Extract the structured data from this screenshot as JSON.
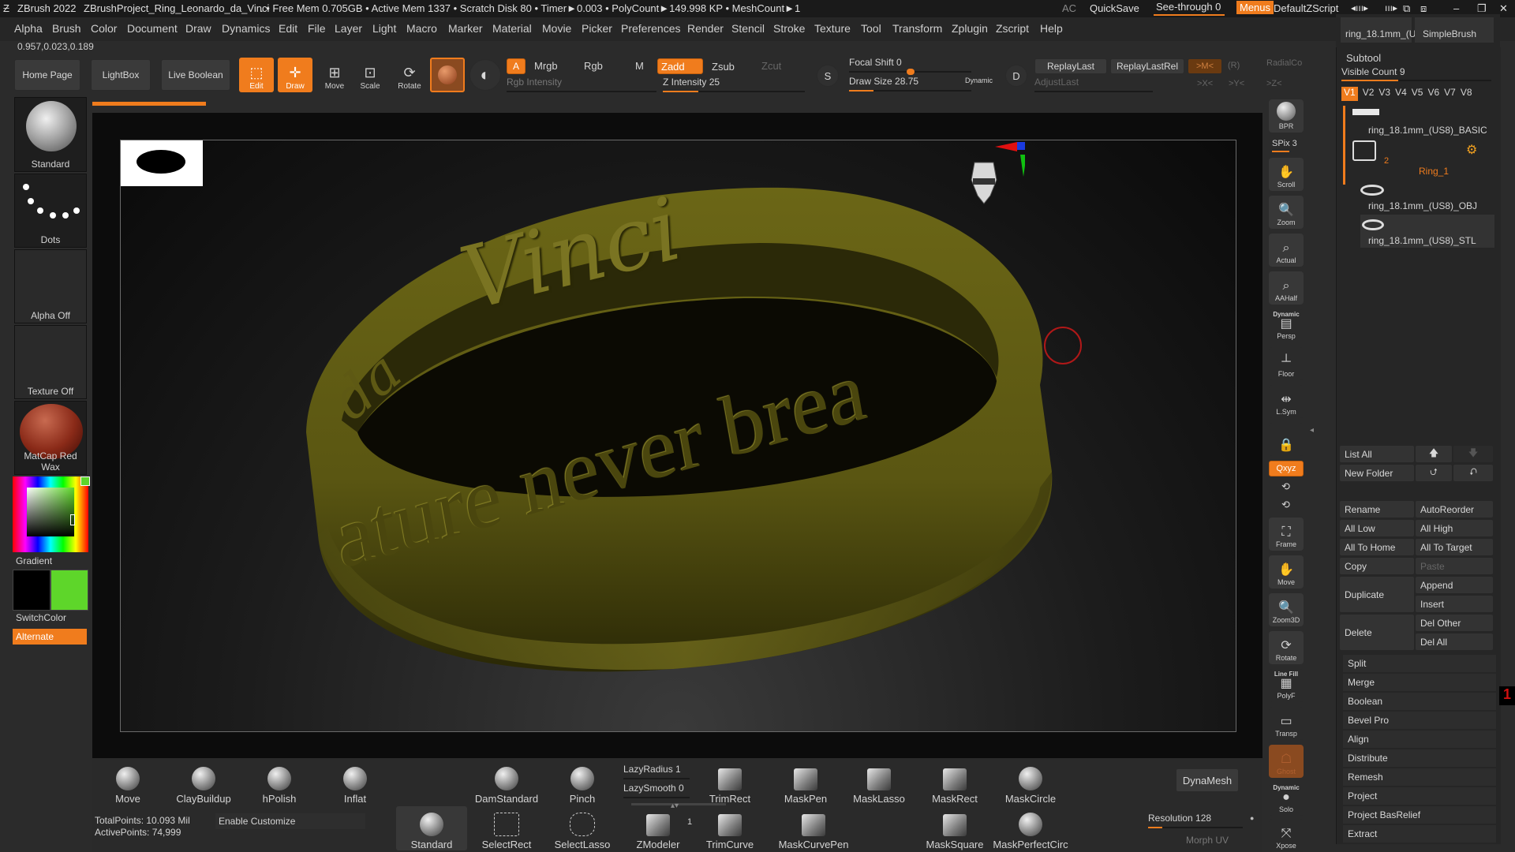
{
  "titlebar": {
    "app": "ZBrush 2022",
    "project": "ZBrushProject_Ring_Leonardo_da_Vinci",
    "stats": ". • Free Mem 0.705GB • Active Mem 1337 • Scratch Disk 80 • Timer►0.003 • PolyCount►149.998 KP • MeshCount►1",
    "ac": "AC",
    "quicksave": "QuickSave",
    "see_through": "See-through 0",
    "menus": "Menus",
    "default_zscript": "DefaultZScript"
  },
  "menubar": [
    "Alpha",
    "Brush",
    "Color",
    "Document",
    "Draw",
    "Dynamics",
    "Edit",
    "File",
    "Layer",
    "Light",
    "Macro",
    "Marker",
    "Material",
    "Movie",
    "Picker",
    "Preferences",
    "Render",
    "Stencil",
    "Stroke",
    "Texture",
    "Tool",
    "Transform",
    "Zplugin",
    "Zscript",
    "Help"
  ],
  "coords": "0.957,0.023,0.189",
  "top_tools": {
    "home_page": "Home Page",
    "lightbox": "LightBox",
    "live_boolean": "Live Boolean",
    "edit": "Edit",
    "draw": "Draw",
    "move": "Move",
    "scale": "Scale",
    "rotate": "Rotate",
    "a": "A",
    "mrgb": "Mrgb",
    "rgb": "Rgb",
    "m": "M",
    "zadd": "Zadd",
    "zsub": "Zsub",
    "zcut": "Zcut",
    "rgb_intensity": "Rgb Intensity",
    "z_intensity": "Z Intensity 25",
    "z_intensity_level": 0.25,
    "focal_shift": "Focal Shift 0",
    "focal_shift_level": 0.5,
    "draw_size": "Draw Size 28.75",
    "draw_size_level": 0.2,
    "dynamic": "Dynamic",
    "replay_last": "ReplayLast",
    "replay_last_rel": "ReplayLastRel",
    "adjust_last": "AdjustLast",
    "radial_co": "RadialCo",
    "x_axis": ">X<",
    "y_axis": ">Y<",
    "z_axis": ">Z<",
    "m_key": ">M<",
    "r_key": "(R)",
    "s_key": "S",
    "d_key": "D"
  },
  "left_panel": {
    "standard": "Standard",
    "dots": "Dots",
    "alpha_off": "Alpha Off",
    "texture_off": "Texture Off",
    "matcap": "MatCap Red Wax",
    "gradient": "Gradient",
    "switch_color": "SwitchColor",
    "alternate": "Alternate"
  },
  "viewport": {
    "ring_text": "Vinci",
    "ring_text_2": "ature never brea",
    "ring_text_3": "da"
  },
  "right_strip": {
    "bpr": "BPR",
    "spix": "SPix 3",
    "scroll": "Scroll",
    "zoom": "Zoom",
    "actual": "Actual",
    "aahalf": "AAHalf",
    "dynamic_persp": "Dynamic",
    "persp": "Persp",
    "floor": "Floor",
    "lsym": "L.Sym",
    "xyz": "Qxyz",
    "frame": "Frame",
    "move": "Move",
    "zoom3d": "Zoom3D",
    "rotate": "Rotate",
    "line_fill": "Line Fill",
    "polyf": "PolyF",
    "transp": "Transp",
    "ghost": "Ghost",
    "dynamic_solo": "Dynamic",
    "solo": "Solo",
    "xpose": "Xpose"
  },
  "top_right": {
    "ring_tool": "ring_18.1mm_(U",
    "simple_brush": "SimpleBrush"
  },
  "subtool": {
    "title": "Subtool",
    "visible_count": "Visible Count 9",
    "versions": [
      "V1",
      "V2",
      "V3",
      "V4",
      "V5",
      "V6",
      "V7",
      "V8"
    ],
    "items": [
      "ring_18.1mm_(US8)_BASIC",
      "Ring_1",
      "ring_18.1mm_(US8)_OBJ",
      "ring_18.1mm_(US8)_STL"
    ],
    "folder_count": "2",
    "list_all": "List All",
    "new_folder": "New Folder",
    "rename": "Rename",
    "auto_reorder": "AutoReorder",
    "all_low": "All Low",
    "all_high": "All High",
    "all_to_home": "All To Home",
    "all_to_target": "All To Target",
    "copy": "Copy",
    "paste": "Paste",
    "duplicate": "Duplicate",
    "append": "Append",
    "insert": "Insert",
    "delete": "Delete",
    "del_other": "Del Other",
    "del_all": "Del All",
    "sections": [
      "Split",
      "Merge",
      "Boolean",
      "Bevel Pro",
      "Align",
      "Distribute",
      "Remesh",
      "Project",
      "Project BasRelief",
      "Extract"
    ]
  },
  "bottom": {
    "brushes_row1": [
      "Move",
      "ClayBuildup",
      "hPolish",
      "Inflat",
      "DamStandard",
      "Pinch",
      "TrimRect",
      "MaskPen",
      "MaskLasso",
      "MaskRect",
      "MaskCircle"
    ],
    "lazy_radius": "LazyRadius 1",
    "lazy_smooth": "LazySmooth 0",
    "dynamesh": "DynaMesh",
    "total_points": "TotalPoints: 10.093 Mil",
    "active_points": "ActivePoints: 74,999",
    "enable_customize": "Enable Customize",
    "brushes_row2": [
      "Standard",
      "SelectRect",
      "SelectLasso",
      "ZModeler",
      "TrimCurve",
      "MaskCurvePen",
      "MaskSquare",
      "MaskPerfectCirc"
    ],
    "zmodeler_count": "1",
    "resolution": "Resolution 128",
    "resolution_level": 0.15,
    "morph_uv": "Morph UV"
  },
  "colors": {
    "accent": "#f07c1d",
    "ring": "#6b6616",
    "primary_color": "#000000",
    "secondary_color": "#5ed62a"
  }
}
